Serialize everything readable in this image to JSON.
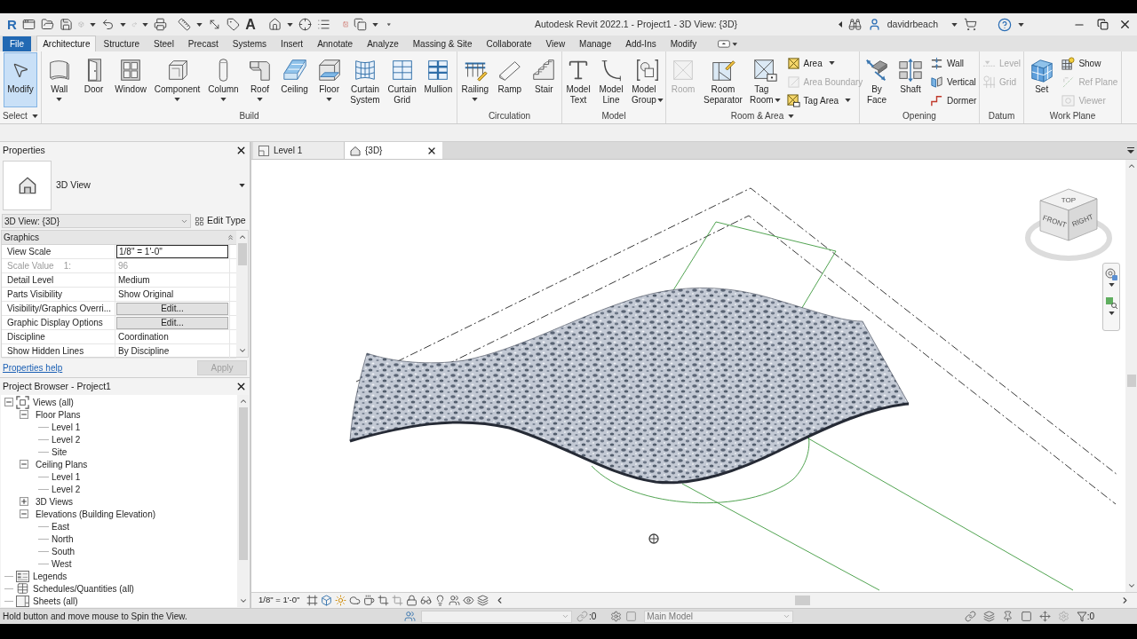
{
  "title_bar": {
    "logo": "R",
    "text_tool": "A",
    "title": "Autodesk Revit 2022.1 - Project1 - 3D View: {3D}",
    "user": "davidrbeach"
  },
  "ribbon_tabs": [
    {
      "label": "File",
      "kind": "file",
      "selected": false
    },
    {
      "label": "Architecture",
      "kind": "tab",
      "selected": true
    },
    {
      "label": "Structure",
      "kind": "tab",
      "selected": false
    },
    {
      "label": "Steel",
      "kind": "tab",
      "selected": false
    },
    {
      "label": "Precast",
      "kind": "tab",
      "selected": false
    },
    {
      "label": "Systems",
      "kind": "tab",
      "selected": false
    },
    {
      "label": "Insert",
      "kind": "tab",
      "selected": false
    },
    {
      "label": "Annotate",
      "kind": "tab",
      "selected": false
    },
    {
      "label": "Analyze",
      "kind": "tab",
      "selected": false
    },
    {
      "label": "Massing & Site",
      "kind": "tab",
      "selected": false
    },
    {
      "label": "Collaborate",
      "kind": "tab",
      "selected": false
    },
    {
      "label": "View",
      "kind": "tab",
      "selected": false
    },
    {
      "label": "Manage",
      "kind": "tab",
      "selected": false
    },
    {
      "label": "Add-Ins",
      "kind": "tab",
      "selected": false
    },
    {
      "label": "Modify",
      "kind": "tab",
      "selected": false
    }
  ],
  "ribbon_panels": [
    {
      "title": "Select",
      "menu": true,
      "tools": [
        {
          "kind": "large",
          "label": "Modify",
          "selected": true,
          "disabled": false,
          "dropdown": false
        }
      ]
    },
    {
      "title": "Build",
      "menu": false,
      "tools": [
        {
          "kind": "large",
          "label": "Wall",
          "selected": false,
          "disabled": false,
          "dropdown": true
        },
        {
          "kind": "large",
          "label": "Door",
          "selected": false,
          "disabled": false,
          "dropdown": false
        },
        {
          "kind": "large",
          "label": "Window",
          "selected": false,
          "disabled": false,
          "dropdown": false
        },
        {
          "kind": "large",
          "label": "Component",
          "selected": false,
          "disabled": false,
          "dropdown": true
        },
        {
          "kind": "large",
          "label": "Column",
          "selected": false,
          "disabled": false,
          "dropdown": true
        },
        {
          "kind": "large",
          "label": "Roof",
          "selected": false,
          "disabled": false,
          "dropdown": true
        },
        {
          "kind": "large",
          "label": "Ceiling",
          "selected": false,
          "disabled": false,
          "dropdown": false
        },
        {
          "kind": "large",
          "label": "Floor",
          "selected": false,
          "disabled": false,
          "dropdown": true
        },
        {
          "kind": "large",
          "label": "Curtain\nSystem",
          "selected": false,
          "disabled": false,
          "dropdown": false
        },
        {
          "kind": "large",
          "label": "Curtain\nGrid",
          "selected": false,
          "disabled": false,
          "dropdown": false
        },
        {
          "kind": "large",
          "label": "Mullion",
          "selected": false,
          "disabled": false,
          "dropdown": false
        }
      ]
    },
    {
      "title": "Circulation",
      "menu": false,
      "tools": [
        {
          "kind": "large",
          "label": "Railing",
          "selected": false,
          "disabled": false,
          "dropdown": true
        },
        {
          "kind": "large",
          "label": "Ramp",
          "selected": false,
          "disabled": false,
          "dropdown": false
        },
        {
          "kind": "large",
          "label": "Stair",
          "selected": false,
          "disabled": false,
          "dropdown": false
        }
      ]
    },
    {
      "title": "Model",
      "menu": false,
      "tools": [
        {
          "kind": "large",
          "label": "Model\nText",
          "selected": false,
          "disabled": false,
          "dropdown": false
        },
        {
          "kind": "large",
          "label": "Model\nLine",
          "selected": false,
          "disabled": false,
          "dropdown": false
        },
        {
          "kind": "split",
          "label": "Model\nGroup",
          "selected": false,
          "disabled": false,
          "dropdown": true
        }
      ]
    },
    {
      "title": "Room & Area",
      "menu": true,
      "tools": [
        {
          "kind": "large",
          "label": "Room",
          "selected": false,
          "disabled": true,
          "dropdown": false
        },
        {
          "kind": "large",
          "label": "Room\nSeparator",
          "selected": false,
          "disabled": false,
          "dropdown": false
        },
        {
          "kind": "split",
          "label": "Tag\nRoom",
          "selected": false,
          "disabled": false,
          "dropdown": true
        },
        {
          "kind": "stack",
          "items": [
            {
              "label": "Area",
              "selected": false,
              "disabled": false,
              "dropdown": true
            },
            {
              "label": "Area Boundary",
              "selected": false,
              "disabled": true,
              "dropdown": false
            },
            {
              "label": "Tag Area",
              "selected": false,
              "disabled": false,
              "dropdown": true
            }
          ]
        }
      ]
    },
    {
      "title": "Opening",
      "menu": false,
      "tools": [
        {
          "kind": "large",
          "label": "By\nFace",
          "selected": false,
          "disabled": false,
          "dropdown": false
        },
        {
          "kind": "large",
          "label": "Shaft",
          "selected": false,
          "disabled": false,
          "dropdown": false
        },
        {
          "kind": "stack",
          "items": [
            {
              "label": "Wall",
              "selected": false,
              "disabled": false,
              "dropdown": false
            },
            {
              "label": "Vertical",
              "selected": false,
              "disabled": false,
              "dropdown": false
            },
            {
              "label": "Dormer",
              "selected": false,
              "disabled": false,
              "dropdown": false
            }
          ]
        }
      ]
    },
    {
      "title": "Datum",
      "menu": false,
      "tools": [
        {
          "kind": "stack",
          "items": [
            {
              "label": "Level",
              "selected": false,
              "disabled": true,
              "dropdown": false
            },
            {
              "label": "Grid",
              "selected": false,
              "disabled": true,
              "dropdown": false
            }
          ]
        }
      ]
    },
    {
      "title": "Work Plane",
      "menu": false,
      "tools": [
        {
          "kind": "large",
          "label": "Set",
          "selected": false,
          "disabled": false,
          "dropdown": false
        },
        {
          "kind": "stack",
          "items": [
            {
              "label": "Show",
              "selected": false,
              "disabled": false,
              "dropdown": false
            },
            {
              "label": "Ref Plane",
              "selected": false,
              "disabled": true,
              "dropdown": false
            },
            {
              "label": "Viewer",
              "selected": false,
              "disabled": true,
              "dropdown": false
            }
          ]
        }
      ]
    }
  ],
  "properties": {
    "title": "Properties",
    "type_name": "3D View",
    "instance_selector": "3D View: {3D}",
    "edit_type": "Edit Type",
    "group": {
      "label": "Graphics",
      "expanded": true
    },
    "rows": [
      {
        "name": "View Scale",
        "value": "1/8\" = 1'-0\"",
        "kind": "input",
        "disabled": false
      },
      {
        "name": "Scale Value    1:",
        "value": "96",
        "kind": "text",
        "disabled": true
      },
      {
        "name": "Detail Level",
        "value": "Medium",
        "kind": "text",
        "disabled": false
      },
      {
        "name": "Parts Visibility",
        "value": "Show Original",
        "kind": "text",
        "disabled": false
      },
      {
        "name": "Visibility/Graphics Overri...",
        "value": "Edit...",
        "kind": "button",
        "disabled": false
      },
      {
        "name": "Graphic Display Options",
        "value": "Edit...",
        "kind": "button",
        "disabled": false
      },
      {
        "name": "Discipline",
        "value": "Coordination",
        "kind": "text",
        "disabled": false
      },
      {
        "name": "Show Hidden Lines",
        "value": "By Discipline",
        "kind": "text",
        "disabled": false
      }
    ],
    "help_link": "Properties help",
    "apply": {
      "label": "Apply",
      "disabled": true
    }
  },
  "project_browser": {
    "title": "Project Browser - Project1",
    "tree": [
      {
        "label": "Views (all)",
        "kind": "views",
        "expanded": true,
        "children": [
          {
            "label": "Floor Plans",
            "expanded": true,
            "children": [
              {
                "label": "Level 1"
              },
              {
                "label": "Level 2"
              },
              {
                "label": "Site"
              }
            ]
          },
          {
            "label": "Ceiling Plans",
            "expanded": true,
            "children": [
              {
                "label": "Level 1"
              },
              {
                "label": "Level 2"
              }
            ]
          },
          {
            "label": "3D Views",
            "expanded": false
          },
          {
            "label": "Elevations (Building Elevation)",
            "expanded": true,
            "children": [
              {
                "label": "East"
              },
              {
                "label": "North"
              },
              {
                "label": "South"
              },
              {
                "label": "West"
              }
            ]
          }
        ]
      },
      {
        "label": "Legends",
        "kind": "legends"
      },
      {
        "label": "Schedules/Quantities (all)",
        "kind": "schedules"
      },
      {
        "label": "Sheets (all)",
        "kind": "sheets"
      }
    ]
  },
  "view_tabs": [
    {
      "label": "Level 1",
      "kind": "plan",
      "selected": false
    },
    {
      "label": "{3D}",
      "kind": "model",
      "selected": true
    }
  ],
  "view_cube": {
    "faces": [
      "TOP",
      "FRONT",
      "RIGHT"
    ]
  },
  "view_control_bar": {
    "scale": "1/8\" = 1'-0\""
  },
  "status_bar": {
    "message": "Hold button and move mouse to Spin the View.",
    "count_1": ":0",
    "model": "Main Model",
    "filter_count": ":0"
  }
}
